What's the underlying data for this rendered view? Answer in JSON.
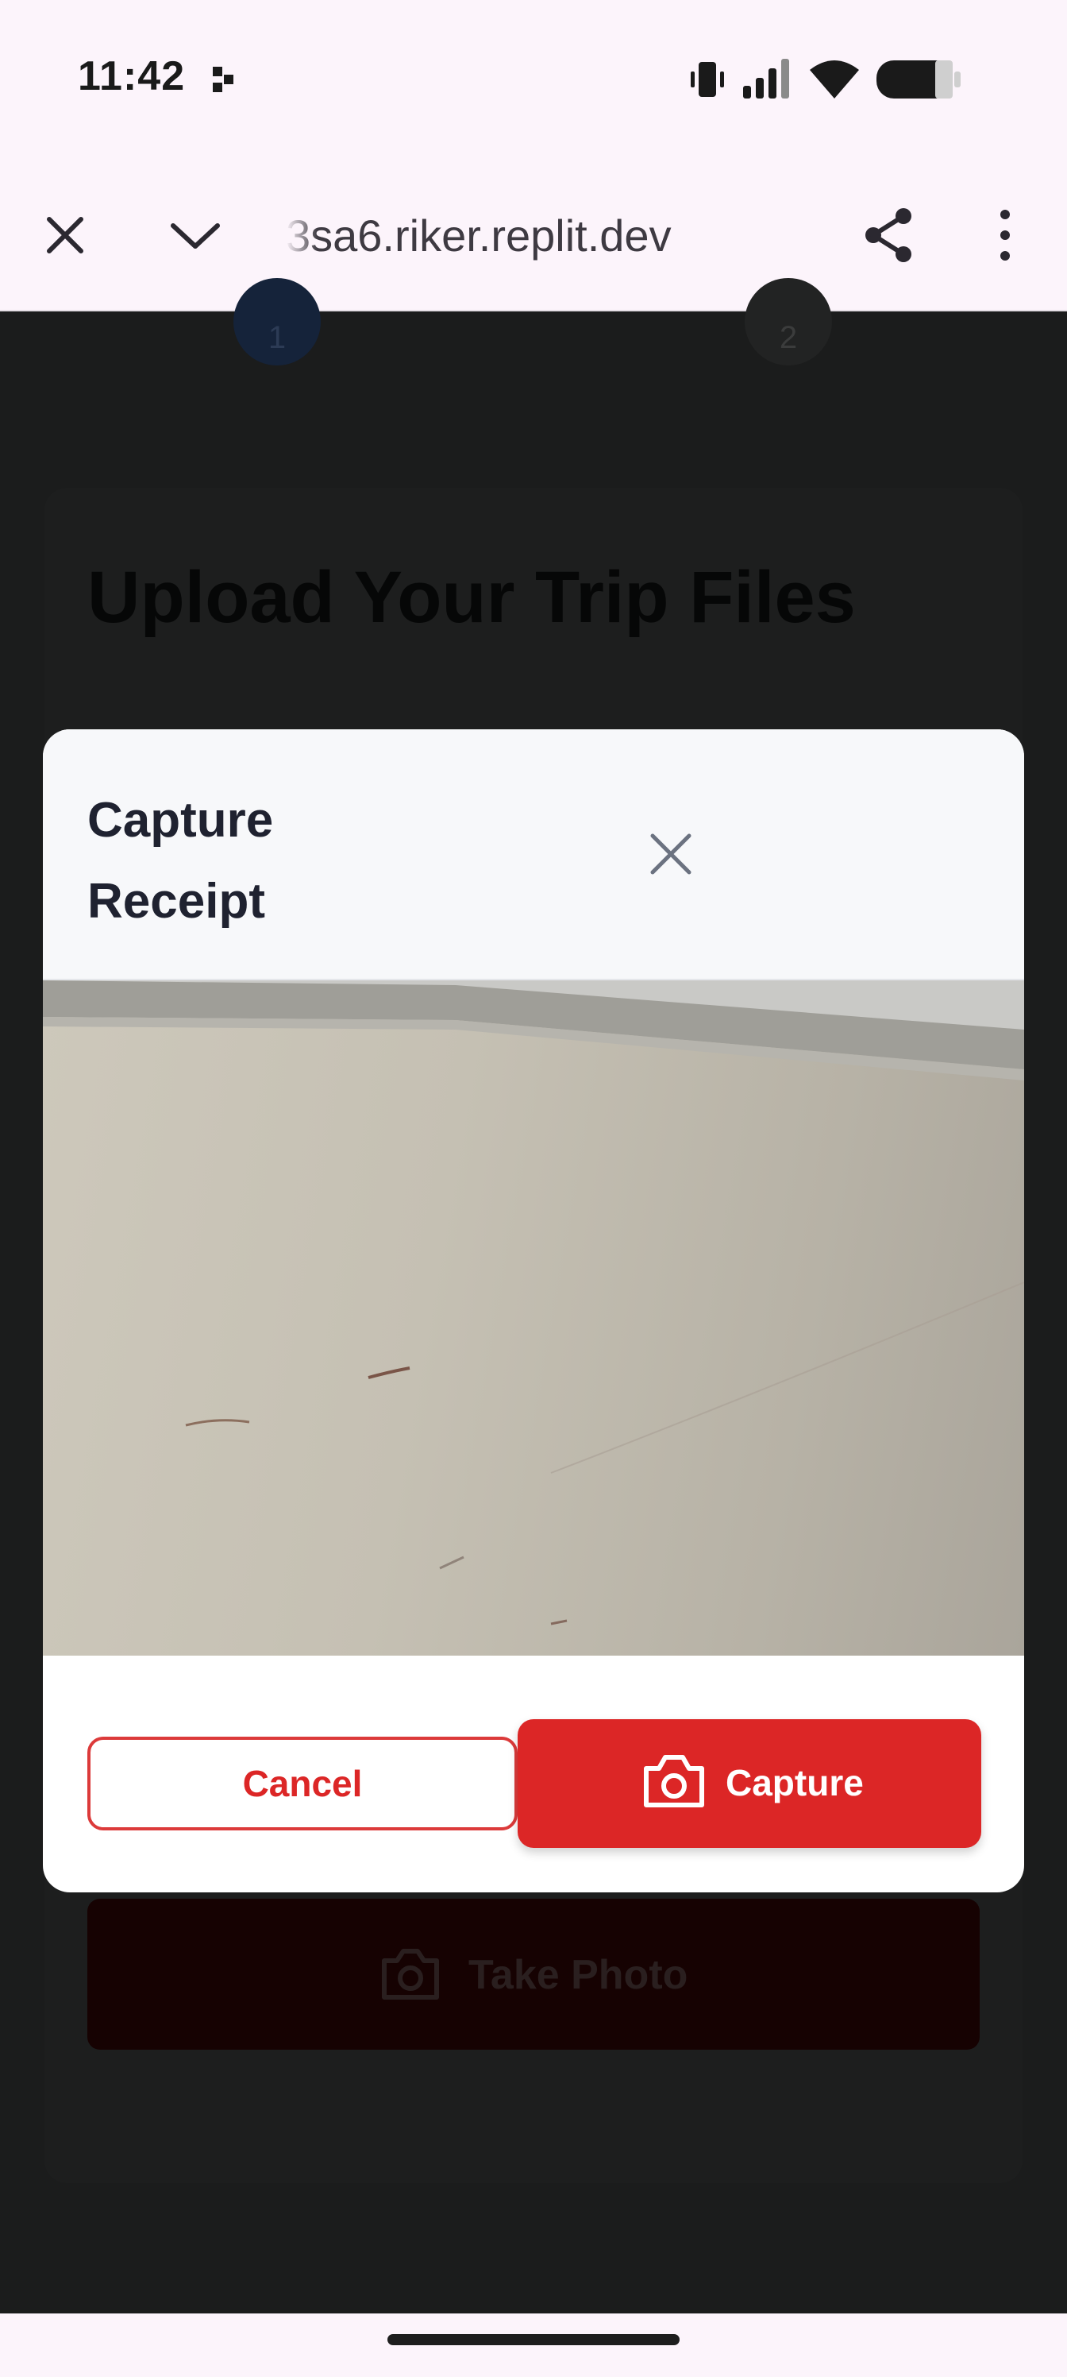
{
  "status_bar": {
    "time": "11:42"
  },
  "browser": {
    "url": "3sa6.riker.replit.dev"
  },
  "background_page": {
    "steps": [
      "1",
      "2"
    ],
    "title": "Upload Your Trip Files",
    "take_photo_label": "Take Photo"
  },
  "modal": {
    "title": "Capture Receipt",
    "cancel_label": "Cancel",
    "capture_label": "Capture"
  },
  "colors": {
    "primary_red": "#dc2626",
    "modal_header_bg": "#f7f8fa",
    "scrim": "#1b1c1c"
  }
}
